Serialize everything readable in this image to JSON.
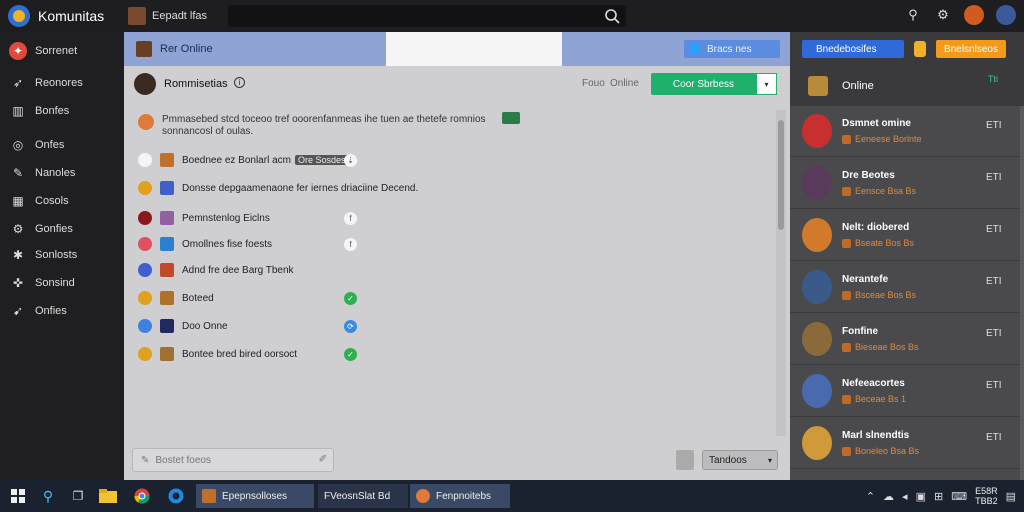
{
  "app": {
    "title": "Komunitas",
    "channel": "Eepadt lfas"
  },
  "sidebar": {
    "items": [
      {
        "label": "Sorrenet",
        "icon": "fire-icon",
        "glyph": "✦",
        "active": true
      },
      {
        "label": "Reonores",
        "icon": "rocket-icon",
        "glyph": "➶"
      },
      {
        "label": "Bonfes",
        "icon": "chart-icon",
        "glyph": "▥"
      },
      {
        "label": "Onfes",
        "icon": "globe-icon",
        "glyph": "◎"
      },
      {
        "label": "Nanoles",
        "icon": "pen-icon",
        "glyph": "✎"
      },
      {
        "label": "Cosols",
        "icon": "grid-icon",
        "glyph": "▦"
      },
      {
        "label": "Gonfies",
        "icon": "gear-icon",
        "glyph": "⚙"
      },
      {
        "label": "Sonlosts",
        "icon": "star-icon",
        "glyph": "✱"
      },
      {
        "label": "Sonsind",
        "icon": "puzzle-icon",
        "glyph": "✜"
      },
      {
        "label": "Onfies",
        "icon": "pin-icon",
        "glyph": "➹"
      }
    ]
  },
  "main": {
    "header_title": "Rer Online",
    "header_button": "Bracs nes",
    "sub_title": "Rommisetias",
    "sub_meta": "Fouo",
    "sub_status": "Online",
    "primary_button": "Coor Sbrbess",
    "notice": "Pmmasebed stcd toceoo tref ooorenfanmeas ihe tuen ae thetefe romnios sonnancosl of oulas.",
    "rows": [
      {
        "text": "Boednee ez Bonlarl acm",
        "tag": "Ore Sosdes",
        "icon_color": "#f5f5f5",
        "thumb": "#c0702a",
        "end_color": "#f5f5f5",
        "end_glyph": "⇣"
      },
      {
        "text": "Donsse depgaamenaone fer iernes driaciine Decend.",
        "tag": "",
        "icon_color": "#e0a020",
        "thumb": "#4060c8",
        "end_color": "",
        "end_glyph": ""
      },
      {
        "text": "Pemnstenlog Eiclns",
        "tag": "",
        "icon_color": "#8a1a1a",
        "thumb": "#9060a0",
        "end_color": "#f5f5f5",
        "end_glyph": "f"
      },
      {
        "text": "Omollnes fise foests",
        "tag": "",
        "icon_color": "#e05060",
        "thumb": "#2a80d0",
        "end_color": "#f5f5f5",
        "end_glyph": "f"
      },
      {
        "text": "Adnd fre dee Barg Tbenk",
        "tag": "",
        "icon_color": "#4060d0",
        "thumb": "#c04a2a",
        "end_color": "",
        "end_glyph": ""
      },
      {
        "text": "Boteed",
        "tag": "",
        "icon_color": "#e0a020",
        "thumb": "#b0702a",
        "end_color": "#2fb050",
        "end_glyph": "✓"
      },
      {
        "text": "Doo Onne",
        "tag": "",
        "icon_color": "#4080e0",
        "thumb": "#202a60",
        "end_color": "#3a8ae0",
        "end_glyph": "⟳"
      },
      {
        "text": "Bontee bred bired oorsoct",
        "tag": "",
        "icon_color": "#e0a020",
        "thumb": "#a07030",
        "end_color": "#2fb050",
        "end_glyph": "✓"
      }
    ],
    "composer_placeholder": "Bostet foeos",
    "send_select": "Tandoos"
  },
  "right": {
    "btn_primary": "Bnedebosifes",
    "btn_secondary": "Bnelsnlseos",
    "online_label": "Online",
    "online_count": "Tti",
    "friends": [
      {
        "name": "Dsmnet omine",
        "sub": "Eeneese Borlnte",
        "color": "#c83030",
        "action": "ETI"
      },
      {
        "name": "Dre Beotes",
        "sub": "Eensce Bsa Bs",
        "color": "#5a3a5a",
        "action": "ETI"
      },
      {
        "name": "Nelt: diobered",
        "sub": "Bseate Bos Bs",
        "color": "#d07a2a",
        "action": "ETI"
      },
      {
        "name": "Nerantefe",
        "sub": "Bsceae Bos Bs",
        "color": "#3a5a8a",
        "action": "ETI"
      },
      {
        "name": "Fonfine",
        "sub": "Bieseae Bos Bs",
        "color": "#8a6a3a",
        "action": "ETI"
      },
      {
        "name": "Nefeeacortes",
        "sub": "Beceae Bs 1",
        "color": "#4a6ab0",
        "action": "ETI"
      },
      {
        "name": "Marl slnendtis",
        "sub": "Boneleo Bsa Bs",
        "color": "#d09a3a",
        "action": "ETI"
      }
    ]
  },
  "taskbar": {
    "apps": [
      "Epepnsolloses",
      "FVeosnSlat Bd",
      "Fenpnoitebs"
    ],
    "clock_time": "E58R",
    "clock_date": "TBB2"
  }
}
